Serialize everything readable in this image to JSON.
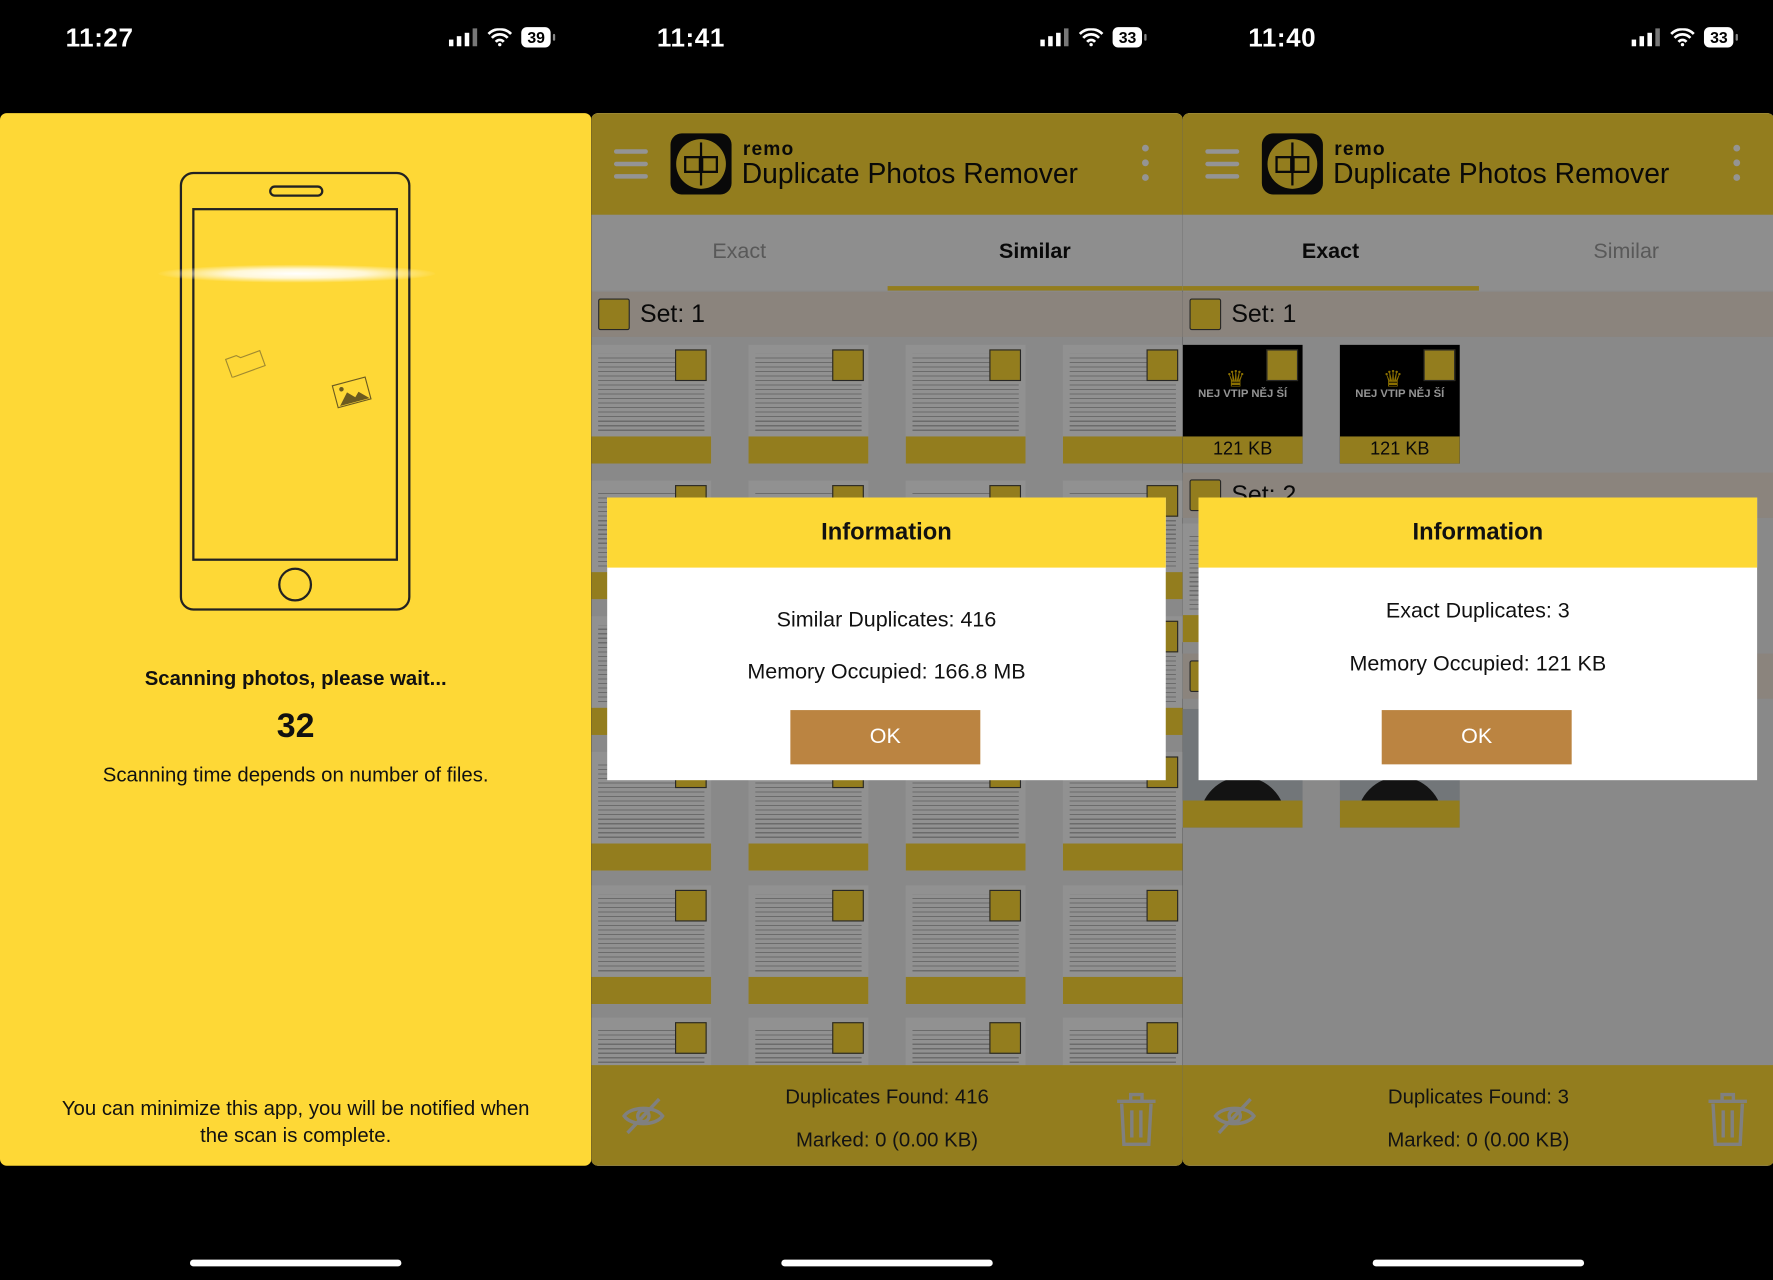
{
  "colors": {
    "accent": "#fdd835",
    "ok_button": "#bb8441",
    "background": "#000000"
  },
  "screens": [
    {
      "status": {
        "time": "11:27",
        "battery": "39"
      },
      "scan": {
        "status": "Scanning photos, please wait...",
        "count": "32",
        "note": "Scanning time depends on number of files.",
        "hint": "You can minimize this app, you will be notified when the scan is complete."
      }
    },
    {
      "status": {
        "time": "11:41",
        "battery": "33"
      },
      "header": {
        "brand": "remo",
        "title": "Duplicate Photos Remover"
      },
      "tabs": [
        {
          "label": "Exact",
          "active": false
        },
        {
          "label": "Similar",
          "active": true
        }
      ],
      "set_label": "Set: 1",
      "dialog": {
        "title": "Information",
        "line1": "Similar Duplicates: 416",
        "line2": "Memory Occupied: 166.8 MB",
        "ok": "OK"
      },
      "footer": {
        "found": "Duplicates Found: 416",
        "marked": "Marked: 0 (0.00 KB)"
      }
    },
    {
      "status": {
        "time": "11:40",
        "battery": "33"
      },
      "header": {
        "brand": "remo",
        "title": "Duplicate Photos Remover"
      },
      "tabs": [
        {
          "label": "Exact",
          "active": true
        },
        {
          "label": "Similar",
          "active": false
        }
      ],
      "sets": [
        {
          "label": "Set: 1",
          "sizes": [
            "121 KB",
            "121 KB"
          ],
          "thumb_text": "NEJ VTIP NĚJ ŠÍ"
        },
        {
          "label": "Set: 2"
        }
      ],
      "dialog": {
        "title": "Information",
        "line1": "Exact Duplicates: 3",
        "line2": "Memory Occupied: 121 KB",
        "ok": "OK"
      },
      "footer": {
        "found": "Duplicates Found: 3",
        "marked": "Marked: 0 (0.00 KB)"
      }
    }
  ]
}
